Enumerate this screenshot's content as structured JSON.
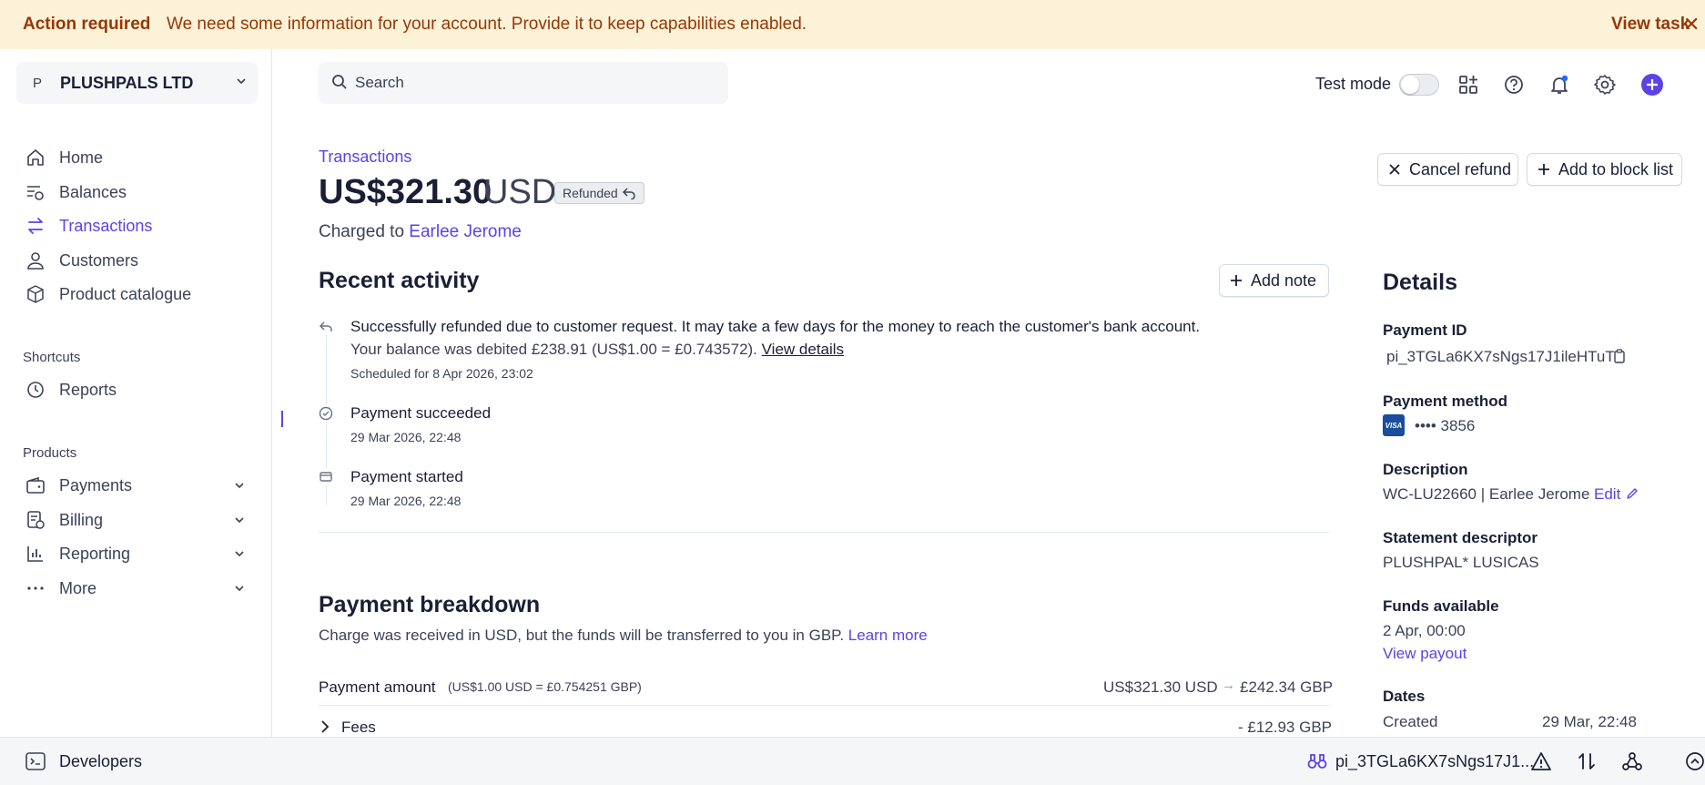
{
  "banner": {
    "title": "Action required",
    "message": "We need some information for your account. Provide it to keep capabilities enabled.",
    "action": "View task",
    "close": "✕"
  },
  "account": {
    "initial": "P",
    "name": "PLUSHPALS LTD"
  },
  "nav": {
    "home": "Home",
    "balances": "Balances",
    "transactions": "Transactions",
    "customers": "Customers",
    "product_catalogue": "Product catalogue",
    "shortcuts_label": "Shortcuts",
    "reports": "Reports",
    "products_label": "Products",
    "payments": "Payments",
    "billing": "Billing",
    "reporting": "Reporting",
    "more": "More"
  },
  "search": {
    "placeholder": "Search"
  },
  "topbar": {
    "test_mode": "Test mode"
  },
  "header": {
    "breadcrumb": "Transactions",
    "amount": "US$321.30",
    "currency": "USD",
    "badge": "Refunded",
    "charged_prefix": "Charged to",
    "customer": "Earlee Jerome",
    "cancel_refund": "Cancel refund",
    "add_block": "Add to block list"
  },
  "activity": {
    "title": "Recent activity",
    "add_note": "Add note",
    "items": [
      {
        "text": "Successfully refunded due to customer request. It may take a few days for the money to reach the customer's bank account.",
        "text2": "Your balance was debited £238.91 (US$1.00 = £0.743572).",
        "link": "View details",
        "sub": "Scheduled for 8 Apr 2026, 23:02"
      },
      {
        "text": "Payment succeeded",
        "sub": "29 Mar 2026, 22:48"
      },
      {
        "text": "Payment started",
        "sub": "29 Mar 2026, 22:48"
      }
    ]
  },
  "breakdown": {
    "title": "Payment breakdown",
    "desc": "Charge was received in USD, but the funds will be transferred to you in GBP.",
    "learn_more": "Learn more",
    "payment_amount_label": "Payment amount",
    "payment_amount_rate": "(US$1.00 USD = £0.754251 GBP)",
    "payment_amount_from": "US$321.30 USD",
    "payment_amount_to": "£242.34 GBP",
    "fees_label": "Fees",
    "fees_value": "- £12.93 GBP"
  },
  "details": {
    "title": "Details",
    "payment_id_label": "Payment ID",
    "payment_id": "pi_3TGLa6KX7sNgs17J1ileHTuT",
    "payment_method_label": "Payment method",
    "card_brand": "VISA",
    "card_last4": "•••• 3856",
    "description_label": "Description",
    "description": "WC-LU22660 | Earlee Jerome",
    "edit": "Edit",
    "statement_label": "Statement descriptor",
    "statement": "PLUSHPAL* LUSICAS",
    "funds_label": "Funds available",
    "funds_date": "2 Apr, 00:00",
    "view_payout": "View payout",
    "dates_label": "Dates",
    "created_label": "Created",
    "created_value": "29 Mar, 22:48"
  },
  "bottom": {
    "developers": "Developers",
    "object_id": "pi_3TGLa6KX7sNgs17J1..."
  },
  "colors": {
    "accent": "#5b43e6",
    "banner_bg": "#fcf2d8",
    "banner_text": "#983705"
  }
}
